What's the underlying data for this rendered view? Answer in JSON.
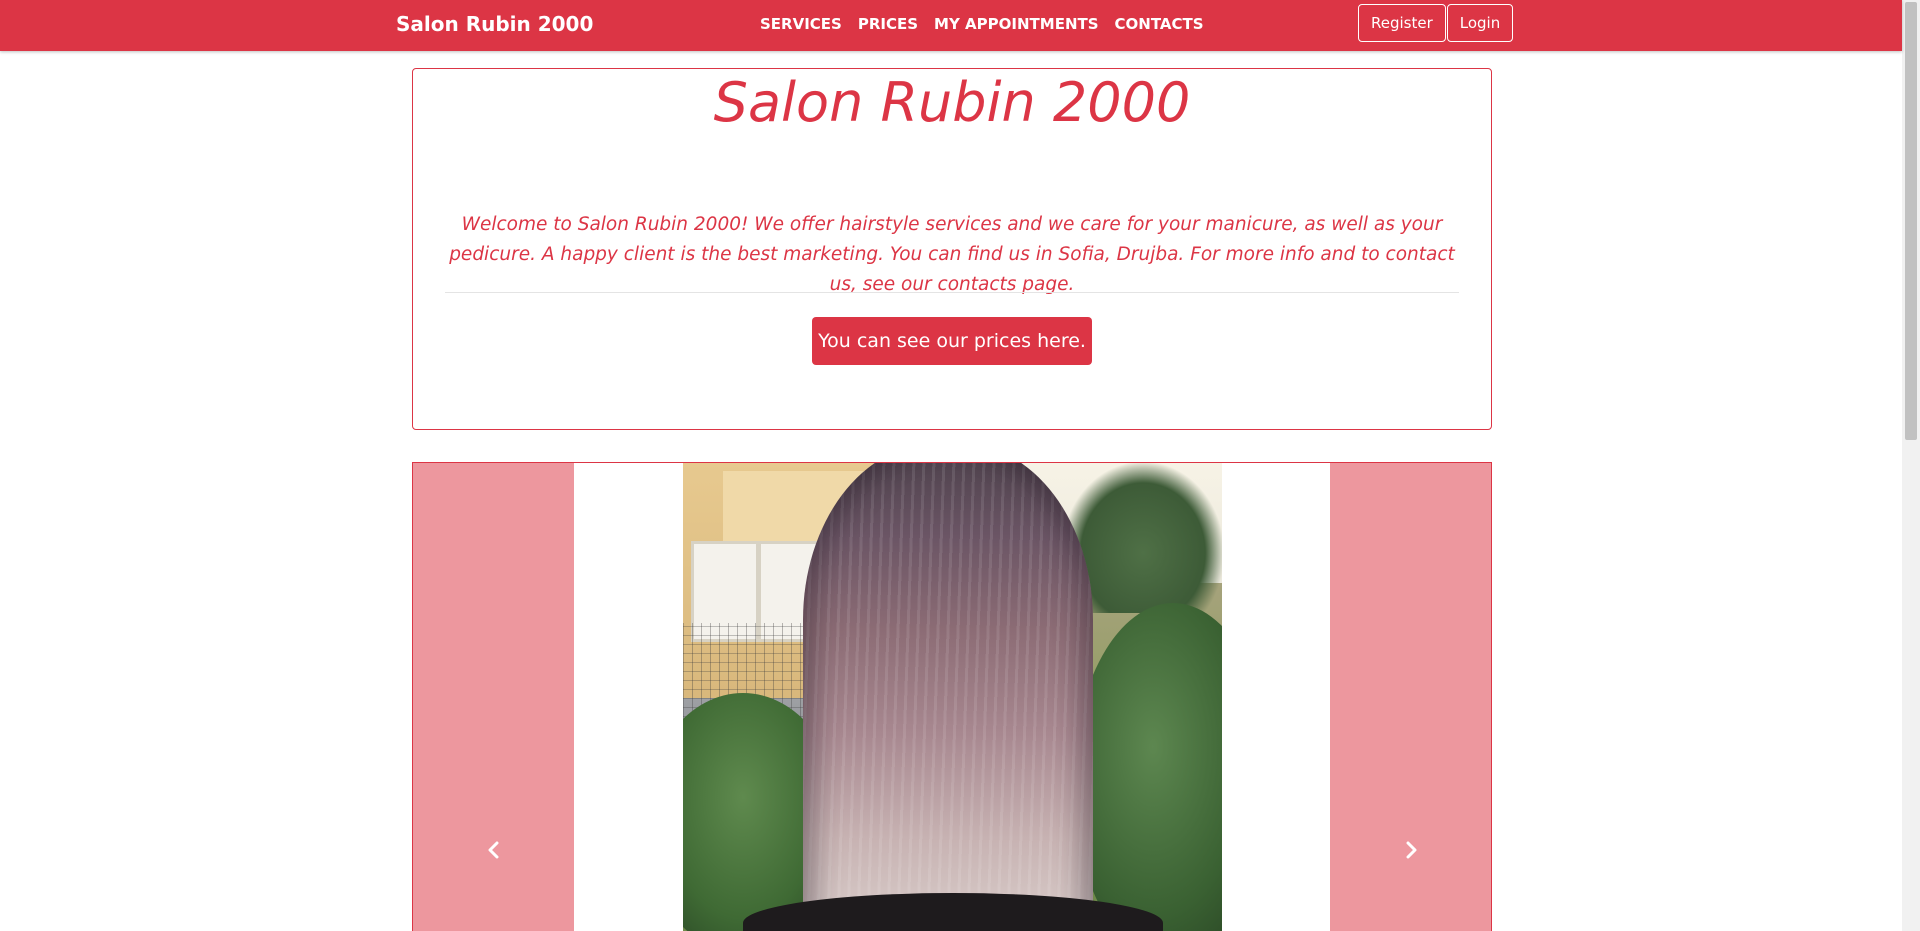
{
  "navbar": {
    "brand": "Salon Rubin 2000",
    "links": [
      "SERVICES",
      "PRICES",
      "MY APPOINTMENTS",
      "CONTACTS"
    ],
    "register_label": "Register",
    "login_label": "Login"
  },
  "jumbotron": {
    "title": "Salon Rubin 2000",
    "lead": "Welcome to Salon Rubin 2000! We offer hairstyle services and we care for your manicure, as well as your pedicure. A happy client is the best marketing. You can find us in Sofia, Drujba. For more info and to contact us, see our contacts page.",
    "cta_label": "You can see our prices here."
  },
  "carousel": {
    "prev_icon": "chevron-left-icon",
    "next_icon": "chevron-right-icon"
  },
  "colors": {
    "brand": "#dc3545",
    "carousel_control": "#ed979e"
  }
}
